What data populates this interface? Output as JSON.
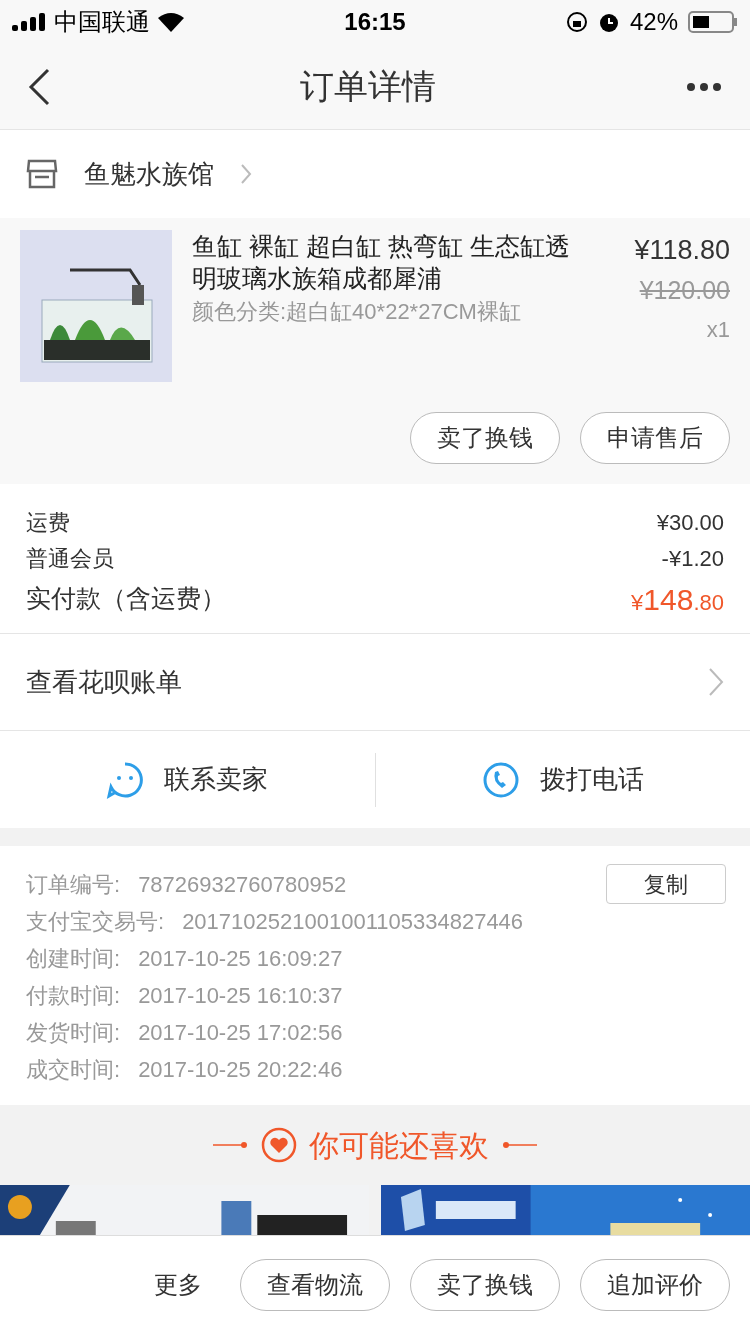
{
  "status_bar": {
    "carrier": "中国联通",
    "time": "16:15",
    "battery": "42%"
  },
  "nav": {
    "title": "订单详情"
  },
  "shop": {
    "name": "鱼魅水族馆"
  },
  "product": {
    "title": "鱼缸 裸缸 超白缸 热弯缸 生态缸透明玻璃水族箱成都犀浦",
    "sku": "颜色分类:超白缸40*22*27CM裸缸",
    "price": "¥118.80",
    "original_price": "¥120.00",
    "quantity": "x1",
    "buttons": [
      "卖了换钱",
      "申请售后"
    ]
  },
  "fees": [
    {
      "label": "运费",
      "value": "¥30.00"
    },
    {
      "label": "普通会员",
      "value": "-¥1.20"
    }
  ],
  "total": {
    "label": "实付款（含运费）",
    "currency": "¥",
    "integer": "148",
    "decimal": ".80"
  },
  "huabei": {
    "label": "查看花呗账单"
  },
  "contact": [
    {
      "kind": "chat",
      "label": "联系卖家"
    },
    {
      "kind": "phone",
      "label": "拨打电话"
    }
  ],
  "order_info": {
    "copy_button": "复制",
    "rows": [
      {
        "label": "订单编号:",
        "value": "78726932760780952"
      },
      {
        "label": "支付宝交易号:",
        "value": "2017102521001001105334827446"
      },
      {
        "label": "创建时间:",
        "value": "2017-10-25 16:09:27"
      },
      {
        "label": "付款时间:",
        "value": "2017-10-25 16:10:37"
      },
      {
        "label": "发货时间:",
        "value": "2017-10-25 17:02:56"
      },
      {
        "label": "成交时间:",
        "value": "2017-10-25 20:22:46"
      }
    ]
  },
  "recommend": {
    "title": "你可能还喜欢"
  },
  "bottom_bar": {
    "more": "更多",
    "buttons": [
      "查看物流",
      "卖了换钱",
      "追加评价"
    ]
  }
}
